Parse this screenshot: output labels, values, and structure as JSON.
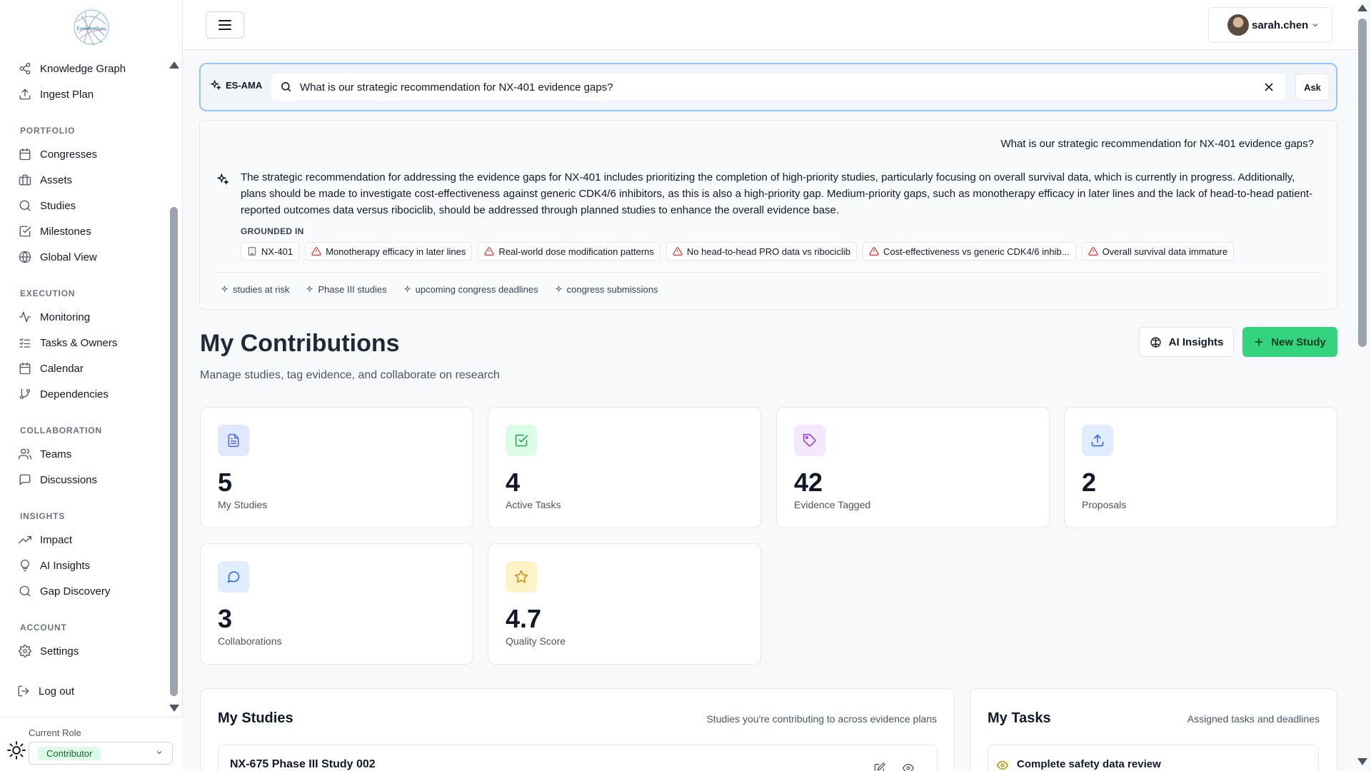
{
  "sidebar": {
    "top_items": [
      {
        "label": "Knowledge Graph"
      },
      {
        "label": "Ingest Plan"
      }
    ],
    "sections": [
      {
        "title": "PORTFOLIO",
        "items": [
          "Congresses",
          "Assets",
          "Studies",
          "Milestones",
          "Global View"
        ]
      },
      {
        "title": "EXECUTION",
        "items": [
          "Monitoring",
          "Tasks & Owners",
          "Calendar",
          "Dependencies"
        ]
      },
      {
        "title": "COLLABORATION",
        "items": [
          "Teams",
          "Discussions"
        ]
      },
      {
        "title": "INSIGHTS",
        "items": [
          "Impact",
          "AI Insights",
          "Gap Discovery"
        ]
      },
      {
        "title": "ACCOUNT",
        "items": [
          "Settings"
        ]
      }
    ],
    "logout": "Log out",
    "role_label": "Current Role",
    "role_value": "Contributor"
  },
  "topbar": {
    "username": "sarah.chen"
  },
  "ama": {
    "tag": "ES-AMA",
    "query": "What is our strategic recommendation for NX-401 evidence gaps?",
    "ask_label": "Ask",
    "question_echo": "What is our strategic recommendation for NX-401 evidence gaps?",
    "answer": "The strategic recommendation for addressing the evidence gaps for NX-401 includes prioritizing the completion of high-priority studies, particularly focusing on overall survival data, which is currently in progress. Additionally, plans should be made to investigate cost-effectiveness against generic CDK4/6 inhibitors, as this is also a high-priority gap. Medium-priority gaps, such as monotherapy efficacy in later lines and the lack of head-to-head patient-reported outcomes data versus ribociclib, should be addressed through planned studies to enhance the overall evidence base.",
    "grounded_label": "GROUNDED IN",
    "sources": [
      {
        "label": "NX-401",
        "icon": "building-icon"
      },
      {
        "label": "Monotherapy efficacy in later lines",
        "icon": "warning-icon"
      },
      {
        "label": "Real-world dose modification patterns",
        "icon": "warning-icon"
      },
      {
        "label": "No head-to-head PRO data vs ribociclib",
        "icon": "warning-icon"
      },
      {
        "label": "Cost-effectiveness vs generic CDK4/6 inhib...",
        "icon": "warning-icon"
      },
      {
        "label": "Overall survival data immature",
        "icon": "warning-icon"
      }
    ],
    "suggestions": [
      "studies at risk",
      "Phase III studies",
      "upcoming congress deadlines",
      "congress submissions"
    ]
  },
  "header": {
    "title": "My Contributions",
    "subtitle": "Manage studies, tag evidence, and collaborate on research",
    "ai_insights_label": "AI Insights",
    "new_study_label": "New Study"
  },
  "stats": [
    {
      "value": "5",
      "label": "My Studies",
      "icon": "document-icon",
      "bg": "#e0e7ff",
      "fg": "#4f6bd8"
    },
    {
      "value": "4",
      "label": "Active Tasks",
      "icon": "check-square-icon",
      "bg": "#dcfce7",
      "fg": "#16a34a"
    },
    {
      "value": "42",
      "label": "Evidence Tagged",
      "icon": "tag-icon",
      "bg": "#f3e8ff",
      "fg": "#9333ea"
    },
    {
      "value": "2",
      "label": "Proposals",
      "icon": "upload-icon",
      "bg": "#e0ecff",
      "fg": "#2563eb"
    },
    {
      "value": "3",
      "label": "Collaborations",
      "icon": "chat-icon",
      "bg": "#e0ecff",
      "fg": "#2563eb"
    },
    {
      "value": "4.7",
      "label": "Quality Score",
      "icon": "star-icon",
      "bg": "#fef3c7",
      "fg": "#ca8a04"
    }
  ],
  "my_studies": {
    "title": "My Studies",
    "description": "Studies you're contributing to across evidence plans",
    "rows": [
      {
        "name": "NX-675 Phase III Study 002"
      }
    ]
  },
  "my_tasks": {
    "title": "My Tasks",
    "description": "Assigned tasks and deadlines",
    "rows": [
      {
        "name": "Complete safety data review"
      }
    ]
  }
}
